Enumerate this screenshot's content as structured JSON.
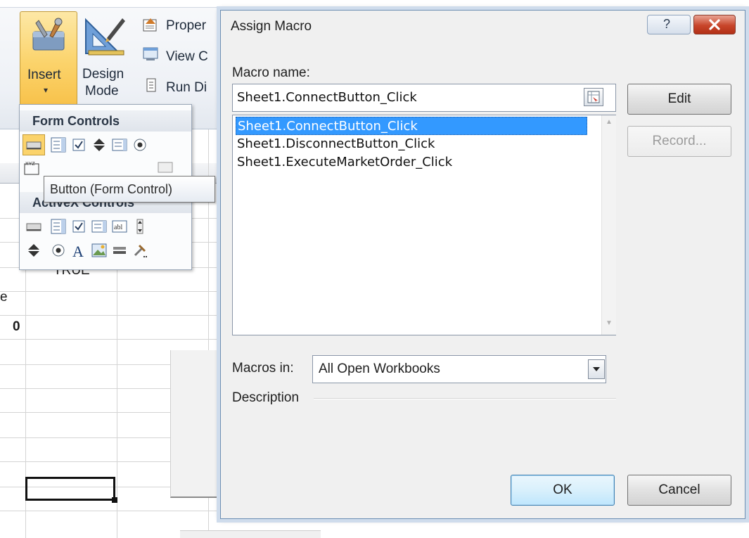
{
  "ribbon": {
    "insert_label": "Insert",
    "design_mode_label_1": "Design",
    "design_mode_label_2": "Mode",
    "properties_label": "Proper",
    "view_code_label": "View C",
    "run_dialog_label": "Run Di"
  },
  "gallery": {
    "form_controls_title": "Form Controls",
    "activex_title": "ActiveX Controls",
    "tooltip": "Button (Form Control)"
  },
  "sheet": {
    "cell_true": "TRUE",
    "cell_e": "e",
    "cell_zero": "0"
  },
  "dialog": {
    "title": "Assign Macro",
    "help_glyph": "?",
    "macro_name_label": "Macro name:",
    "macro_name_value": "Sheet1.ConnectButton_Click",
    "macros": [
      "Sheet1.ConnectButton_Click",
      "Sheet1.DisconnectButton_Click",
      "Sheet1.ExecuteMarketOrder_Click"
    ],
    "selected_index": 0,
    "edit_label": "Edit",
    "record_label": "Record...",
    "macros_in_label": "Macros in:",
    "macros_in_value": "All Open Workbooks",
    "description_label": "Description",
    "ok_label": "OK",
    "cancel_label": "Cancel"
  },
  "colors": {
    "selection": "#3399ff",
    "close_button": "#c8452a",
    "insert_highlight": "#fbd36b"
  }
}
